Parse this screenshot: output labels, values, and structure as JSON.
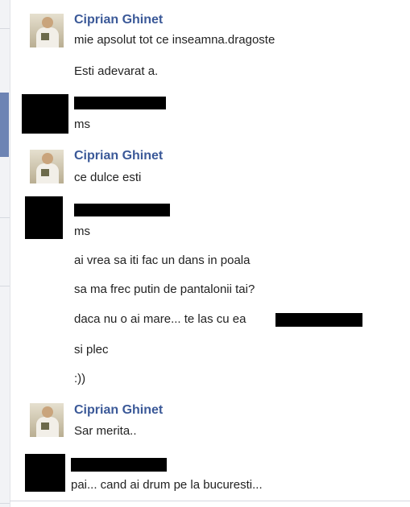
{
  "blocks": [
    {
      "sender": "Ciprian Ghinet",
      "messages": [
        "mie apsolut tot ce inseamna.dragoste",
        "Esti adevarat a."
      ]
    },
    {
      "sender": "",
      "messages": [
        "ms"
      ]
    },
    {
      "sender": "Ciprian Ghinet",
      "messages": [
        "ce dulce esti"
      ]
    },
    {
      "sender": "",
      "messages": [
        "ms",
        "ai vrea sa iti fac un dans in poala",
        "sa ma frec putin de pantalonii tai?",
        "daca nu  o ai mare... te las cu ea",
        "si plec",
        ":))"
      ]
    },
    {
      "sender": "Ciprian Ghinet",
      "messages": [
        "Sar merita.."
      ]
    },
    {
      "sender": "",
      "messages": [
        "pai... cand ai drum pe la bucuresti..."
      ]
    }
  ],
  "colors": {
    "sender_name": "#3b5998",
    "text": "#222222",
    "accent_strip": "#6d84b4"
  },
  "icons": [
    "avatar-photo"
  ]
}
